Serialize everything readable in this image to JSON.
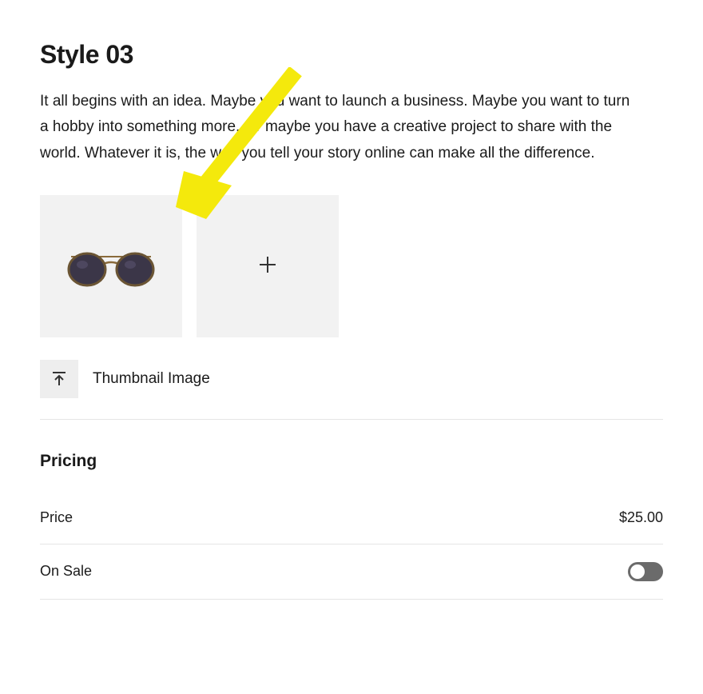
{
  "title": "Style 03",
  "description": "It all begins with an idea. Maybe you want to launch a business. Maybe you want to turn a hobby into something more. Or maybe you have a creative project to share with the world. Whatever it is, the way you tell your story online can make all the difference.",
  "thumbnail": {
    "label": "Thumbnail Image"
  },
  "pricing": {
    "heading": "Pricing",
    "price": {
      "label": "Price",
      "value": "$25.00"
    },
    "on_sale": {
      "label": "On Sale",
      "enabled": false
    }
  },
  "annotation": {
    "color": "#f4e90c"
  }
}
